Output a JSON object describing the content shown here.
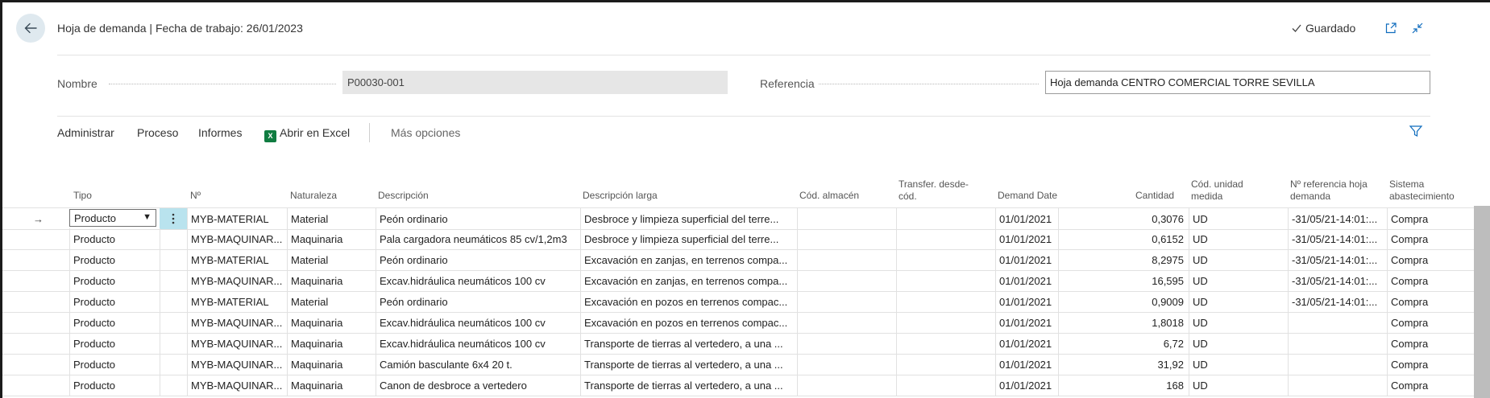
{
  "header": {
    "title": "Hoja de demanda | Fecha de trabajo: 26/01/2023",
    "status": "Guardado"
  },
  "fields": {
    "nombre_label": "Nombre",
    "nombre_value": "P00030-001",
    "referencia_label": "Referencia",
    "referencia_value": "Hoja demanda CENTRO COMERCIAL TORRE SEVILLA"
  },
  "actions": {
    "administrar": "Administrar",
    "proceso": "Proceso",
    "informes": "Informes",
    "excel": "Abrir en Excel",
    "mas": "Más opciones"
  },
  "columns": {
    "tipo": "Tipo",
    "no": "Nº",
    "naturaleza": "Naturaleza",
    "descripcion": "Descripción",
    "descripcion_larga": "Descripción larga",
    "cod_almacen": "Cód. almacén",
    "transfer_1": "Transfer. desde-",
    "transfer_2": "cód.",
    "demand_date": "Demand Date",
    "cantidad": "Cantidad",
    "unidad_1": "Cód. unidad",
    "unidad_2": "medida",
    "ref_1": "Nº referencia hoja",
    "ref_2": "demanda",
    "sistema_1": "Sistema",
    "sistema_2": "abastecimiento"
  },
  "rows": [
    {
      "tipo": "Producto",
      "no": "MYB-MATERIAL",
      "naturaleza": "Material",
      "descripcion": "Peón ordinario",
      "descripcion_larga": "Desbroce y limpieza superficial del terre...",
      "almacen": "",
      "transfer": "",
      "fecha": "01/01/2021",
      "cantidad": "0,3076",
      "unidad": "UD",
      "ref": "-31/05/21-14:01:...",
      "sistema": "Compra"
    },
    {
      "tipo": "Producto",
      "no": "MYB-MAQUINAR...",
      "naturaleza": "Maquinaria",
      "descripcion": "Pala cargadora neumáticos 85 cv/1,2m3",
      "descripcion_larga": "Desbroce y limpieza superficial del terre...",
      "almacen": "",
      "transfer": "",
      "fecha": "01/01/2021",
      "cantidad": "0,6152",
      "unidad": "UD",
      "ref": "-31/05/21-14:01:...",
      "sistema": "Compra"
    },
    {
      "tipo": "Producto",
      "no": "MYB-MATERIAL",
      "naturaleza": "Material",
      "descripcion": "Peón ordinario",
      "descripcion_larga": "Excavación en zanjas, en terrenos compa...",
      "almacen": "",
      "transfer": "",
      "fecha": "01/01/2021",
      "cantidad": "8,2975",
      "unidad": "UD",
      "ref": "-31/05/21-14:01:...",
      "sistema": "Compra"
    },
    {
      "tipo": "Producto",
      "no": "MYB-MAQUINAR...",
      "naturaleza": "Maquinaria",
      "descripcion": "Excav.hidráulica neumáticos 100 cv",
      "descripcion_larga": "Excavación en zanjas, en terrenos compa...",
      "almacen": "",
      "transfer": "",
      "fecha": "01/01/2021",
      "cantidad": "16,595",
      "unidad": "UD",
      "ref": "-31/05/21-14:01:...",
      "sistema": "Compra"
    },
    {
      "tipo": "Producto",
      "no": "MYB-MATERIAL",
      "naturaleza": "Material",
      "descripcion": "Peón ordinario",
      "descripcion_larga": "Excavación en pozos en terrenos compac...",
      "almacen": "",
      "transfer": "",
      "fecha": "01/01/2021",
      "cantidad": "0,9009",
      "unidad": "UD",
      "ref": "-31/05/21-14:01:...",
      "sistema": "Compra"
    },
    {
      "tipo": "Producto",
      "no": "MYB-MAQUINAR...",
      "naturaleza": "Maquinaria",
      "descripcion": "Excav.hidráulica neumáticos 100 cv",
      "descripcion_larga": "Excavación en pozos en terrenos compac...",
      "almacen": "",
      "transfer": "",
      "fecha": "01/01/2021",
      "cantidad": "1,8018",
      "unidad": "UD",
      "ref": "",
      "sistema": "Compra"
    },
    {
      "tipo": "Producto",
      "no": "MYB-MAQUINAR...",
      "naturaleza": "Maquinaria",
      "descripcion": "Excav.hidráulica neumáticos 100 cv",
      "descripcion_larga": "Transporte de tierras al vertedero, a una ...",
      "almacen": "",
      "transfer": "",
      "fecha": "01/01/2021",
      "cantidad": "6,72",
      "unidad": "UD",
      "ref": "",
      "sistema": "Compra"
    },
    {
      "tipo": "Producto",
      "no": "MYB-MAQUINAR...",
      "naturaleza": "Maquinaria",
      "descripcion": "Camión basculante 6x4 20 t.",
      "descripcion_larga": "Transporte de tierras al vertedero, a una ...",
      "almacen": "",
      "transfer": "",
      "fecha": "01/01/2021",
      "cantidad": "31,92",
      "unidad": "UD",
      "ref": "",
      "sistema": "Compra"
    },
    {
      "tipo": "Producto",
      "no": "MYB-MAQUINAR...",
      "naturaleza": "Maquinaria",
      "descripcion": "Canon de desbroce a vertedero",
      "descripcion_larga": "Transporte de tierras al vertedero, a una ...",
      "almacen": "",
      "transfer": "",
      "fecha": "01/01/2021",
      "cantidad": "168",
      "unidad": "UD",
      "ref": "",
      "sistema": "Compra"
    }
  ],
  "icons": {
    "back": "back-arrow-icon",
    "saved": "checkmark-icon",
    "open_new": "open-in-new-window-icon",
    "collapse": "collapse-icon",
    "excel": "excel-icon",
    "filter": "filter-icon",
    "row_marker": "row-arrow-icon",
    "kebab": "more-options-icon"
  },
  "colors": {
    "accent": "#0f6cbd",
    "excel_green": "#107c41",
    "selected_kebab": "#b9e3ee"
  }
}
